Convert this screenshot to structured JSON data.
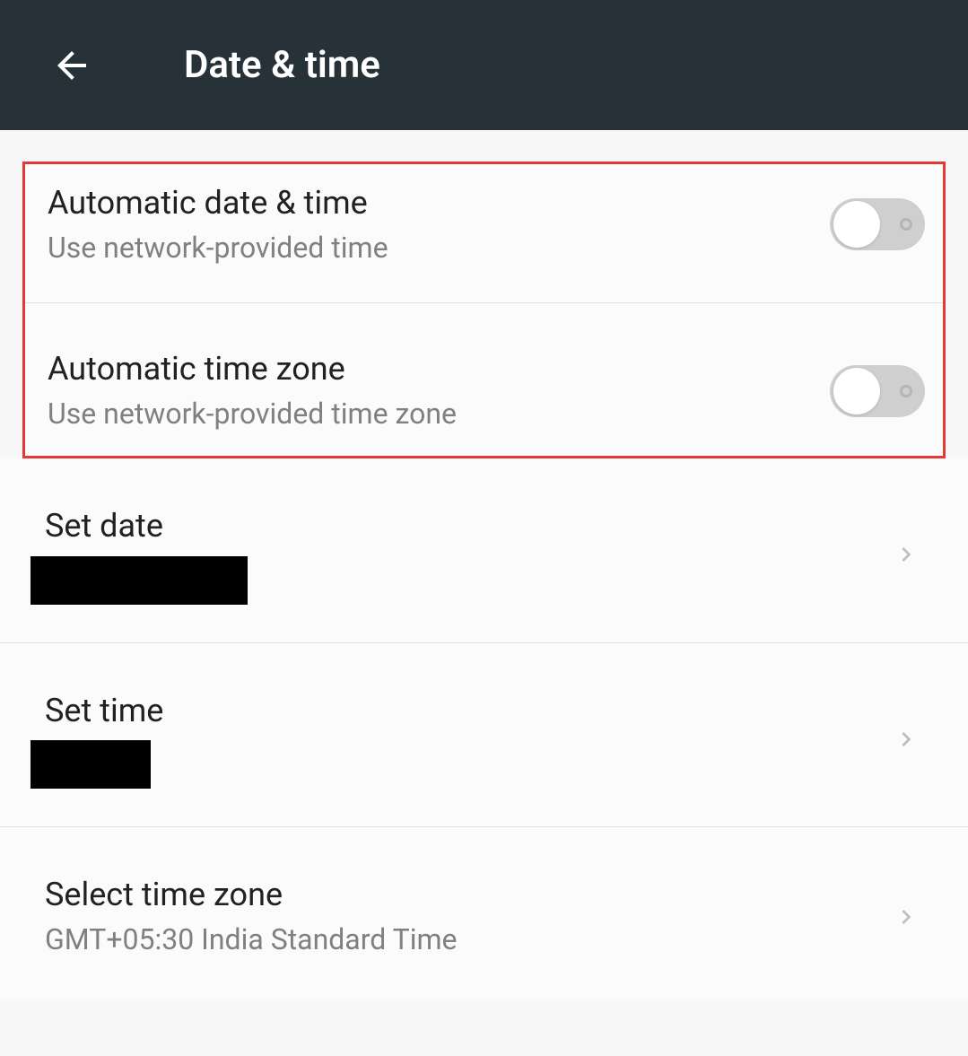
{
  "header": {
    "title": "Date & time"
  },
  "rows": {
    "auto_date_time": {
      "title": "Automatic date & time",
      "sub": "Use network-provided time"
    },
    "auto_time_zone": {
      "title": "Automatic time zone",
      "sub": "Use network-provided time zone"
    },
    "set_date": {
      "title": "Set date"
    },
    "set_time": {
      "title": "Set time"
    },
    "select_time_zone": {
      "title": "Select time zone",
      "sub": "GMT+05:30 India Standard Time"
    }
  }
}
